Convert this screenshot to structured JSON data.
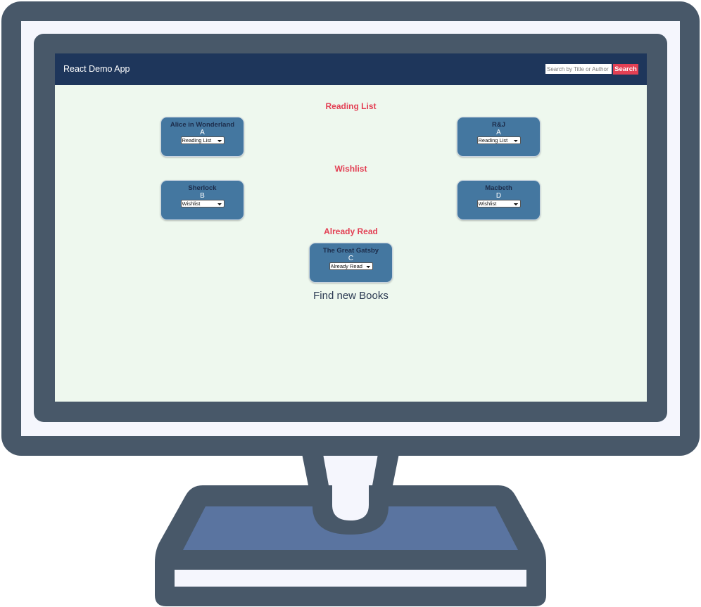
{
  "app": {
    "brand": "React Demo App",
    "search_placeholder": "Search by Title or Author",
    "search_button": "Search"
  },
  "shelf_options": [
    "Reading List",
    "Wishlist",
    "Already Read"
  ],
  "sections": {
    "reading_list": {
      "title": "Reading List",
      "books": [
        {
          "title": "Alice in Wonderland",
          "author": "A",
          "shelf": "Reading List"
        },
        {
          "title": "R&J",
          "author": "A",
          "shelf": "Reading List"
        }
      ]
    },
    "wishlist": {
      "title": "Wishlist",
      "books": [
        {
          "title": "Sherlock",
          "author": "B",
          "shelf": "Wishlist"
        },
        {
          "title": "Macbeth",
          "author": "D",
          "shelf": "Wishlist"
        }
      ]
    },
    "already_read": {
      "title": "Already Read",
      "books": [
        {
          "title": "The Great Gatsby",
          "author": "C",
          "shelf": "Already Read"
        }
      ]
    }
  },
  "find_link": "Find new Books",
  "colors": {
    "monitor_frame": "#485869",
    "monitor_screen_border": "#f5f6fd",
    "monitor_base": "#5a74a0",
    "navbar": "#1e365b",
    "page_background": "#eef8ee",
    "accent": "#e34054",
    "card": "#4477a0",
    "card_title": "#1c2c4a"
  }
}
